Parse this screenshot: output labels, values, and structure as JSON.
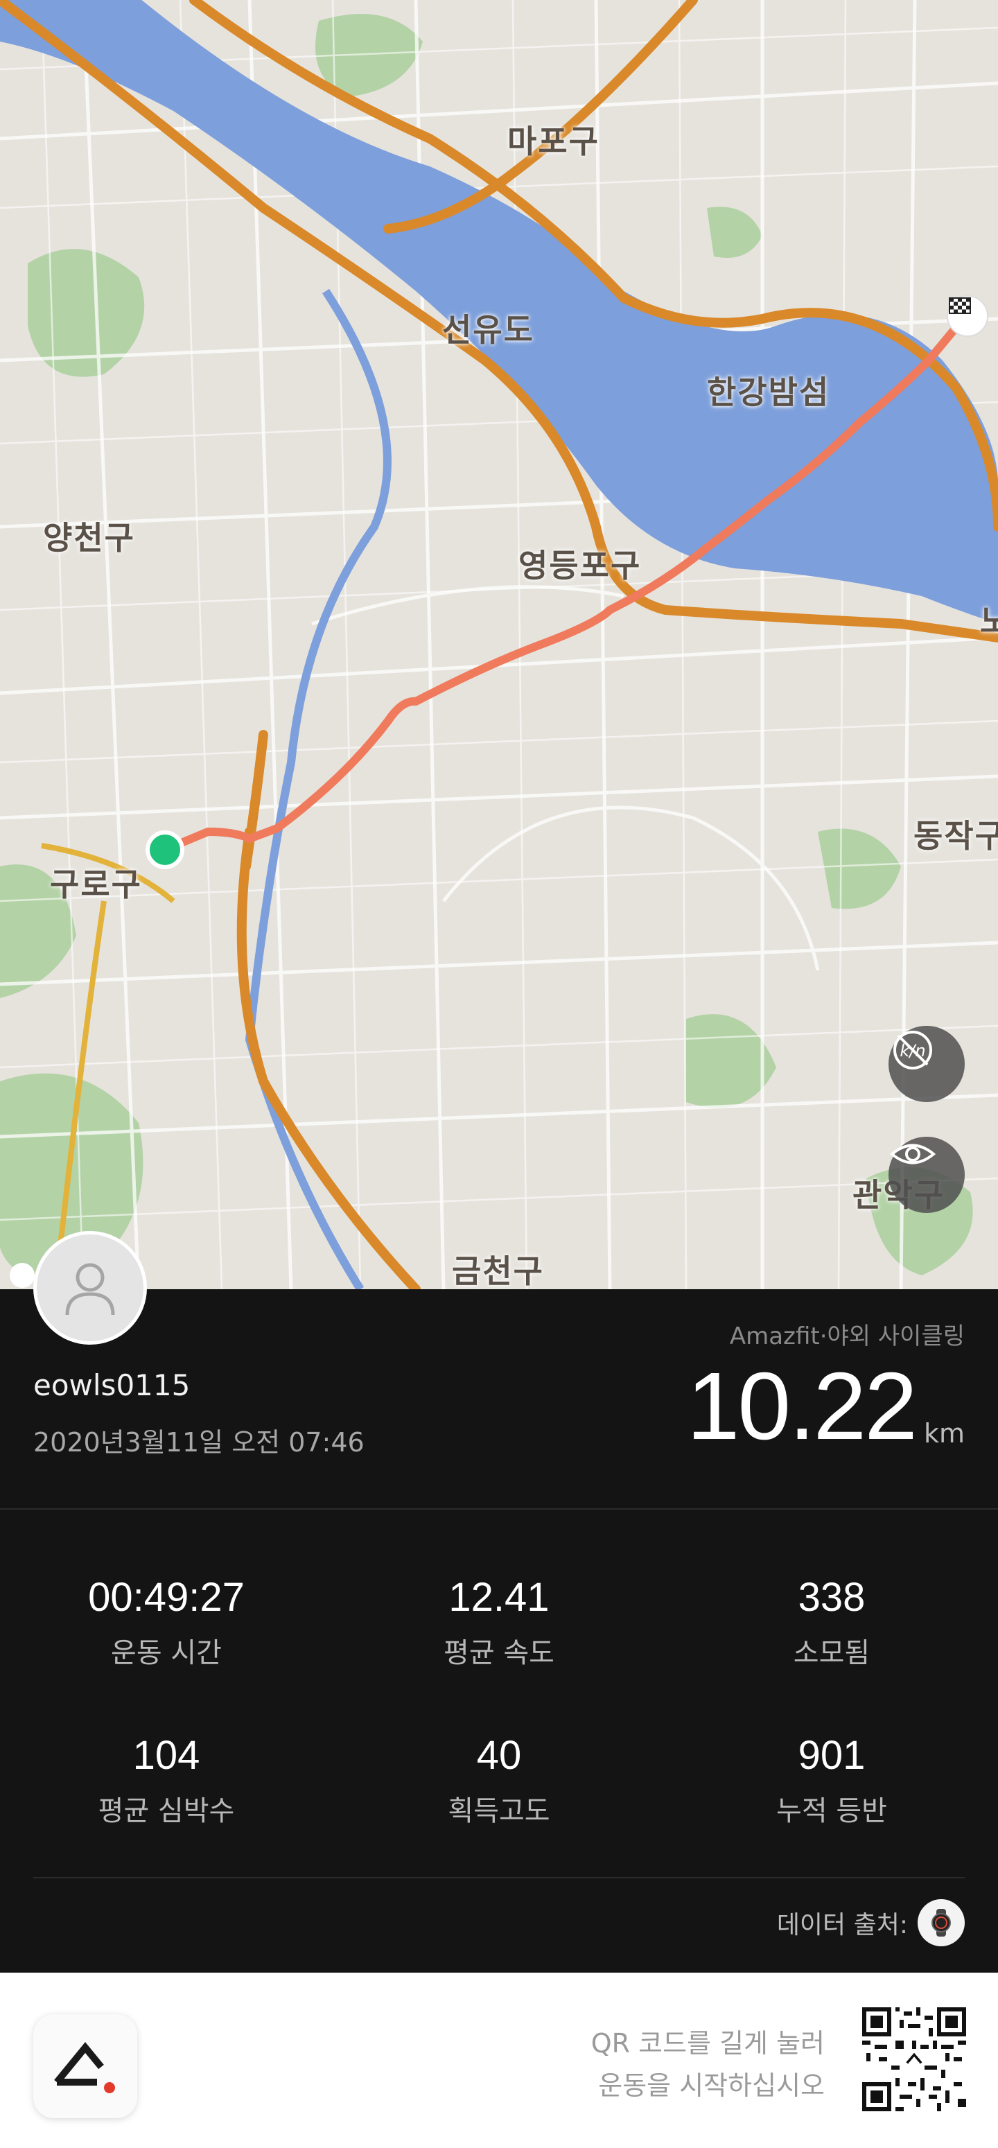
{
  "map": {
    "labels": {
      "mapo": "마포구",
      "seonyudo": "선유도",
      "hangang_bamseom": "한강밤섬",
      "yangcheon": "양천구",
      "yeongdeungpo": "영등포구",
      "guro": "구로구",
      "dongjak": "동작구",
      "gwanak": "관악구",
      "geumcheon": "금천구",
      "edge": "노"
    },
    "controls": {
      "unit_toggle_icon": "km-hide-icon",
      "view_icon": "eye-icon"
    }
  },
  "profile": {
    "username": "eowls0115",
    "datetime": "2020년3월11일 오전 07:46"
  },
  "activity": {
    "source_label": "Amazfit·야외 사이클링",
    "distance_value": "10.22",
    "distance_unit": "km"
  },
  "stats": [
    {
      "value": "00:49:27",
      "label": "운동 시간"
    },
    {
      "value": "12.41",
      "label": "평균 속도"
    },
    {
      "value": "338",
      "label": "소모됨"
    },
    {
      "value": "104",
      "label": "평균 심박수"
    },
    {
      "value": "40",
      "label": "획득고도"
    },
    {
      "value": "901",
      "label": "누적 등반"
    }
  ],
  "data_source": {
    "label": "데이터 출처:",
    "device_icon": "watch-icon"
  },
  "footer": {
    "qr_line1": "QR 코드를 길게 눌러",
    "qr_line2": "운동을 시작하십시오"
  },
  "colors": {
    "route": "#f07a5c",
    "river": "#7d9fdb",
    "highway": "#d9892a",
    "start_marker": "#1fc27a",
    "panel_bg": "#141414"
  }
}
